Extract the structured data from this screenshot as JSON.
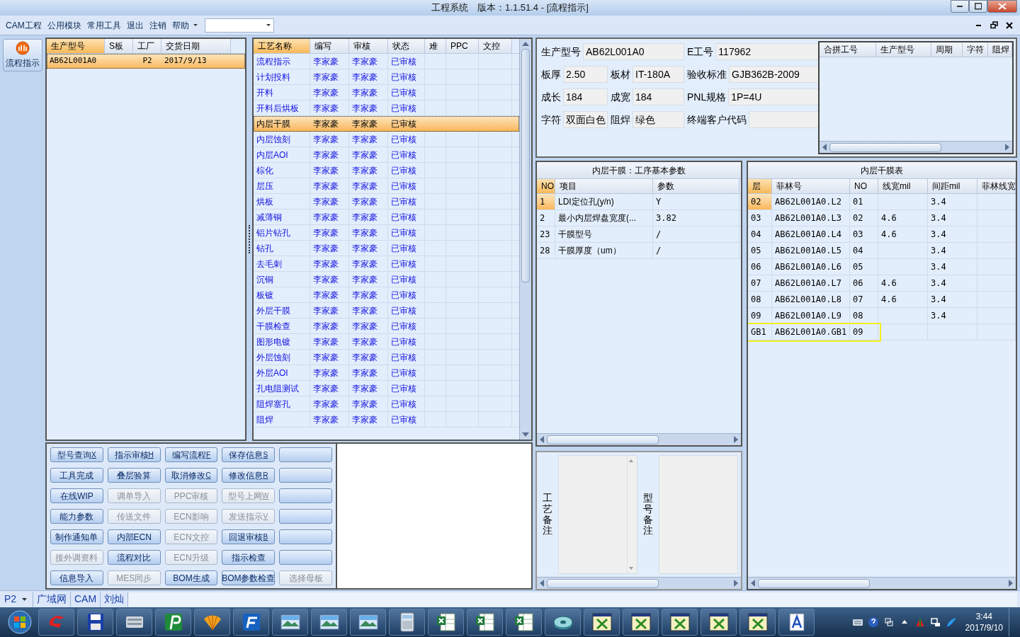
{
  "window": {
    "title": "工程系统　版本：1.1.51.4 - [流程指示]"
  },
  "menu": [
    {
      "label": "CAM工程",
      "has_menu": false
    },
    {
      "label": "公用模块",
      "has_menu": false
    },
    {
      "label": "常用工具",
      "has_menu": false
    },
    {
      "label": "退出",
      "has_menu": false
    },
    {
      "label": "注销",
      "has_menu": false
    },
    {
      "label": "帮助",
      "has_menu": true
    }
  ],
  "sidebar": {
    "button": "流程指示"
  },
  "orders": {
    "columns": [
      {
        "label": "生产型号",
        "sorted": true
      },
      {
        "label": "S板",
        "sorted": false
      },
      {
        "label": "工厂",
        "sorted": false
      },
      {
        "label": "交货日期",
        "sorted": false
      }
    ],
    "rows": [
      {
        "cells": [
          "AB62L001A0",
          null,
          "P2",
          "2017/9/13"
        ],
        "selected": true
      }
    ]
  },
  "processes": {
    "columns": [
      {
        "label": "工艺名称",
        "sorted": true
      },
      {
        "label": "编写",
        "sorted": false
      },
      {
        "label": "审核",
        "sorted": false
      },
      {
        "label": "状态",
        "sorted": false
      },
      {
        "label": "难",
        "sorted": false
      },
      {
        "label": "PPC",
        "sorted": false
      },
      {
        "label": "文控",
        "sorted": false
      }
    ],
    "rows": [
      {
        "cells": [
          "流程指示",
          "李家豪",
          "李家豪",
          "已审核"
        ],
        "selected": false
      },
      {
        "cells": [
          "计划投料",
          "李家豪",
          "李家豪",
          "已审核"
        ],
        "selected": false
      },
      {
        "cells": [
          "开料",
          "李家豪",
          "李家豪",
          "已审核"
        ],
        "selected": false
      },
      {
        "cells": [
          "开料后烘板",
          "李家豪",
          "李家豪",
          "已审核"
        ],
        "selected": false
      },
      {
        "cells": [
          "内层干膜",
          "李家豪",
          "李家豪",
          "已审核"
        ],
        "selected": true
      },
      {
        "cells": [
          "内层蚀刻",
          "李家豪",
          "李家豪",
          "已审核"
        ],
        "selected": false
      },
      {
        "cells": [
          "内层AOI",
          "李家豪",
          "李家豪",
          "已审核"
        ],
        "selected": false
      },
      {
        "cells": [
          "棕化",
          "李家豪",
          "李家豪",
          "已审核"
        ],
        "selected": false
      },
      {
        "cells": [
          "层压",
          "李家豪",
          "李家豪",
          "已审核"
        ],
        "selected": false
      },
      {
        "cells": [
          "烘板",
          "李家豪",
          "李家豪",
          "已审核"
        ],
        "selected": false
      },
      {
        "cells": [
          "减薄铜",
          "李家豪",
          "李家豪",
          "已审核"
        ],
        "selected": false
      },
      {
        "cells": [
          "铝片钻孔",
          "李家豪",
          "李家豪",
          "已审核"
        ],
        "selected": false
      },
      {
        "cells": [
          "钻孔",
          "李家豪",
          "李家豪",
          "已审核"
        ],
        "selected": false
      },
      {
        "cells": [
          "去毛刺",
          "李家豪",
          "李家豪",
          "已审核"
        ],
        "selected": false
      },
      {
        "cells": [
          "沉铜",
          "李家豪",
          "李家豪",
          "已审核"
        ],
        "selected": false
      },
      {
        "cells": [
          "板镀",
          "李家豪",
          "李家豪",
          "已审核"
        ],
        "selected": false
      },
      {
        "cells": [
          "外层干膜",
          "李家豪",
          "李家豪",
          "已审核"
        ],
        "selected": false
      },
      {
        "cells": [
          "干膜检查",
          "李家豪",
          "李家豪",
          "已审核"
        ],
        "selected": false
      },
      {
        "cells": [
          "图形电镀",
          "李家豪",
          "李家豪",
          "已审核"
        ],
        "selected": false
      },
      {
        "cells": [
          "外层蚀刻",
          "李家豪",
          "李家豪",
          "已审核"
        ],
        "selected": false
      },
      {
        "cells": [
          "外层AOI",
          "李家豪",
          "李家豪",
          "已审核"
        ],
        "selected": false
      },
      {
        "cells": [
          "孔电阻测试",
          "李家豪",
          "李家豪",
          "已审核"
        ],
        "selected": false
      },
      {
        "cells": [
          "阻焊塞孔",
          "李家豪",
          "李家豪",
          "已审核"
        ],
        "selected": false
      },
      {
        "cells": [
          "阻焊",
          "李家豪",
          "李家豪",
          "已审核"
        ],
        "selected": false
      }
    ]
  },
  "buttons": [
    {
      "kind": "action",
      "label": "型号查询",
      "accesskey": "X",
      "disabled": false
    },
    {
      "kind": "action",
      "label": "指示审核",
      "accesskey": "H",
      "disabled": false
    },
    {
      "kind": "action",
      "label": "编写流程",
      "accesskey": "F",
      "disabled": false
    },
    {
      "kind": "action",
      "label": "保存信息",
      "accesskey": "S",
      "disabled": false
    },
    {
      "kind": "blank"
    },
    {
      "kind": "action",
      "label": "工具完成",
      "disabled": false
    },
    {
      "kind": "action",
      "label": "叠层验算",
      "disabled": false
    },
    {
      "kind": "action",
      "label": "取消修改",
      "accesskey": "C",
      "disabled": false
    },
    {
      "kind": "action",
      "label": "修改信息",
      "accesskey": "R",
      "disabled": false
    },
    {
      "kind": "blank"
    },
    {
      "kind": "action",
      "label": "在线WIP",
      "disabled": false
    },
    {
      "kind": "action",
      "label": "调单导入",
      "disabled": true
    },
    {
      "kind": "action",
      "label": "PPC审核",
      "disabled": true
    },
    {
      "kind": "action",
      "label": "型号上网",
      "accesskey": "W",
      "disabled": true
    },
    {
      "kind": "blank"
    },
    {
      "kind": "action",
      "label": "能力参数",
      "disabled": false
    },
    {
      "kind": "action",
      "label": "传送文件",
      "disabled": true
    },
    {
      "kind": "action",
      "label": "ECN影响",
      "disabled": true
    },
    {
      "kind": "action",
      "label": "发送指示",
      "accesskey": "V",
      "disabled": true
    },
    {
      "kind": "blank"
    },
    {
      "kind": "action",
      "label": "制作通知单",
      "disabled": false
    },
    {
      "kind": "action",
      "label": "内部ECN",
      "disabled": false
    },
    {
      "kind": "action",
      "label": "ECN文控",
      "disabled": true
    },
    {
      "kind": "action",
      "label": "回退审核",
      "accesskey": "B",
      "disabled": false
    },
    {
      "kind": "blank"
    },
    {
      "kind": "action",
      "label": "接外调资料",
      "disabled": true
    },
    {
      "kind": "action",
      "label": "流程对比",
      "disabled": false
    },
    {
      "kind": "action",
      "label": "ECN升级",
      "disabled": true
    },
    {
      "kind": "action",
      "label": "指示检查",
      "disabled": false
    },
    {
      "kind": "blank"
    },
    {
      "kind": "action",
      "label": "信息导入",
      "disabled": false
    },
    {
      "kind": "action",
      "label": "MES同步",
      "disabled": true
    },
    {
      "kind": "action",
      "label": "BOM生成",
      "disabled": false
    },
    {
      "kind": "action",
      "label": "BOM参数检查",
      "disabled": false
    },
    {
      "kind": "action",
      "label": "选择母板",
      "disabled": true
    }
  ],
  "info": {
    "fields": [
      {
        "label": "生产型号",
        "value": "AB62L001A0"
      },
      {
        "label": "E工号",
        "value": "117962"
      },
      {
        "label": "板厚",
        "value": "2.50"
      },
      {
        "label": "板材",
        "value": "IT-180A"
      },
      {
        "label": "验收标准",
        "value": "GJB362B-2009"
      },
      {
        "label": "成长",
        "value": "184"
      },
      {
        "label": "成宽",
        "value": "184"
      },
      {
        "label": "PNL规格",
        "value": "1P=4U"
      },
      {
        "label": "字符",
        "value": "双面白色"
      },
      {
        "label": "阻焊",
        "value": "绿色"
      },
      {
        "label": "终端客户代码"
      }
    ]
  },
  "merge_table": {
    "columns": [
      "合拼工号",
      "生产型号",
      "周期",
      "字符",
      "阻焊"
    ]
  },
  "params": {
    "title": "内层干膜：工序基本参数",
    "columns": [
      {
        "label": "NO",
        "sorted": true
      },
      {
        "label": "项目",
        "sorted": false
      },
      {
        "label": "参数",
        "sorted": false
      }
    ],
    "rows": [
      {
        "cells": [
          "1",
          "LDI定位孔(y/n)",
          "Y"
        ],
        "current": true
      },
      {
        "cells": [
          "2",
          "最小内层焊盘宽度(...",
          "3.82"
        ],
        "current": false
      },
      {
        "cells": [
          "23",
          "干膜型号",
          "/"
        ],
        "current": false
      },
      {
        "cells": [
          "28",
          "干膜厚度（um）",
          "/"
        ],
        "current": false
      }
    ]
  },
  "layers": {
    "title": "内层干膜表",
    "columns": [
      {
        "label": "层",
        "sorted": true
      },
      {
        "label": "菲林号",
        "sorted": false
      },
      {
        "label": "NO",
        "sorted": false
      },
      {
        "label": "线宽mil",
        "sorted": false
      },
      {
        "label": "间距mil",
        "sorted": false
      },
      {
        "label": "菲林线宽",
        "sorted": false
      }
    ],
    "rows": [
      {
        "cells": [
          "02",
          "AB62L001A0.L2",
          "01",
          null,
          "3.4",
          null
        ],
        "current": true,
        "highlighted": false
      },
      {
        "cells": [
          "03",
          "AB62L001A0.L3",
          "02",
          "4.6",
          "3.4",
          null
        ],
        "current": false,
        "highlighted": false
      },
      {
        "cells": [
          "04",
          "AB62L001A0.L4",
          "03",
          "4.6",
          "3.4",
          null
        ],
        "current": false,
        "highlighted": false
      },
      {
        "cells": [
          "05",
          "AB62L001A0.L5",
          "04",
          null,
          "3.4",
          null
        ],
        "current": false,
        "highlighted": false
      },
      {
        "cells": [
          "06",
          "AB62L001A0.L6",
          "05",
          null,
          "3.4",
          null
        ],
        "current": false,
        "highlighted": false
      },
      {
        "cells": [
          "07",
          "AB62L001A0.L7",
          "06",
          "4.6",
          "3.4",
          null
        ],
        "current": false,
        "highlighted": false
      },
      {
        "cells": [
          "08",
          "AB62L001A0.L8",
          "07",
          "4.6",
          "3.4",
          null
        ],
        "current": false,
        "highlighted": false
      },
      {
        "cells": [
          "09",
          "AB62L001A0.L9",
          "08",
          null,
          "3.4",
          null
        ],
        "current": false,
        "highlighted": false
      },
      {
        "cells": [
          "GB1",
          "AB62L001A0.GB1",
          "09",
          null,
          null,
          null
        ],
        "current": false,
        "highlighted": true
      }
    ]
  },
  "notes": [
    {
      "label": "工艺备注"
    },
    {
      "label": "型号备注"
    }
  ],
  "status_bar": {
    "factory": "P2",
    "items": [
      "广域网",
      "CAM",
      "刘灿"
    ]
  },
  "taskbar": {
    "time": "3:44",
    "date": "2017/9/10"
  }
}
